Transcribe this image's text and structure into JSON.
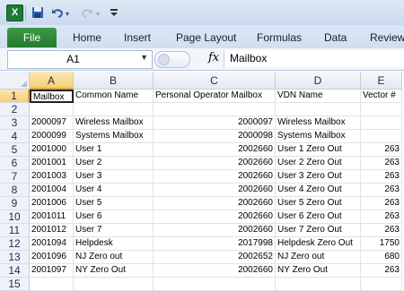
{
  "qat": {
    "app_icon": "X",
    "save_icon": "save-icon",
    "undo_icon": "undo-icon",
    "redo_icon": "redo-icon",
    "customize_icon": "customize-icon"
  },
  "ribbon": {
    "file": "File",
    "tabs": [
      "Home",
      "Insert",
      "Page Layout",
      "Formulas",
      "Data",
      "Review"
    ]
  },
  "formula_bar": {
    "name_box": "A1",
    "fx": "fx",
    "content": "Mailbox"
  },
  "columns": [
    "A",
    "B",
    "C",
    "D",
    "E"
  ],
  "rows": [
    {
      "num": "1",
      "cells": [
        "Mailbox",
        "Common Name",
        "Personal Operator Mailbox",
        "VDN Name",
        "Vector #"
      ]
    },
    {
      "num": "2",
      "cells": [
        "",
        "",
        "",
        "",
        ""
      ]
    },
    {
      "num": "3",
      "cells": [
        "2000097",
        "Wireless Mailbox",
        "2000097",
        "Wireless Mailbox",
        ""
      ]
    },
    {
      "num": "4",
      "cells": [
        "2000099",
        "Systems Mailbox",
        "2000098",
        "Systems Mailbox",
        ""
      ]
    },
    {
      "num": "5",
      "cells": [
        "2001000",
        "User 1",
        "2002660",
        "User 1 Zero Out",
        "263"
      ]
    },
    {
      "num": "6",
      "cells": [
        "2001001",
        "User 2",
        "2002660",
        "User 2 Zero Out",
        "263"
      ]
    },
    {
      "num": "7",
      "cells": [
        "2001003",
        "User 3",
        "2002660",
        "User 3 Zero Out",
        "263"
      ]
    },
    {
      "num": "8",
      "cells": [
        "2001004",
        "User 4",
        "2002660",
        "User 4 Zero Out",
        "263"
      ]
    },
    {
      "num": "9",
      "cells": [
        "2001006",
        "User 5",
        "2002660",
        "User 5 Zero Out",
        "263"
      ]
    },
    {
      "num": "10",
      "cells": [
        "2001011",
        "User 6",
        "2002660",
        "User 6 Zero Out",
        "263"
      ]
    },
    {
      "num": "11",
      "cells": [
        "2001012",
        "User 7",
        "2002660",
        "User 7 Zero Out",
        "263"
      ]
    },
    {
      "num": "12",
      "cells": [
        "2001094",
        "Helpdesk",
        "2017998",
        "Helpdesk Zero Out",
        "1750"
      ]
    },
    {
      "num": "13",
      "cells": [
        "2001096",
        "NJ Zero out",
        "2002652",
        "NJ Zero out",
        "680"
      ]
    },
    {
      "num": "14",
      "cells": [
        "2001097",
        "NY Zero Out",
        "2002660",
        "NY Zero Out",
        "263"
      ]
    },
    {
      "num": "15",
      "cells": [
        "",
        "",
        "",
        "",
        ""
      ]
    }
  ],
  "colors": {
    "file_tab": "#2f8a3a",
    "selection": "#f5cf76"
  }
}
